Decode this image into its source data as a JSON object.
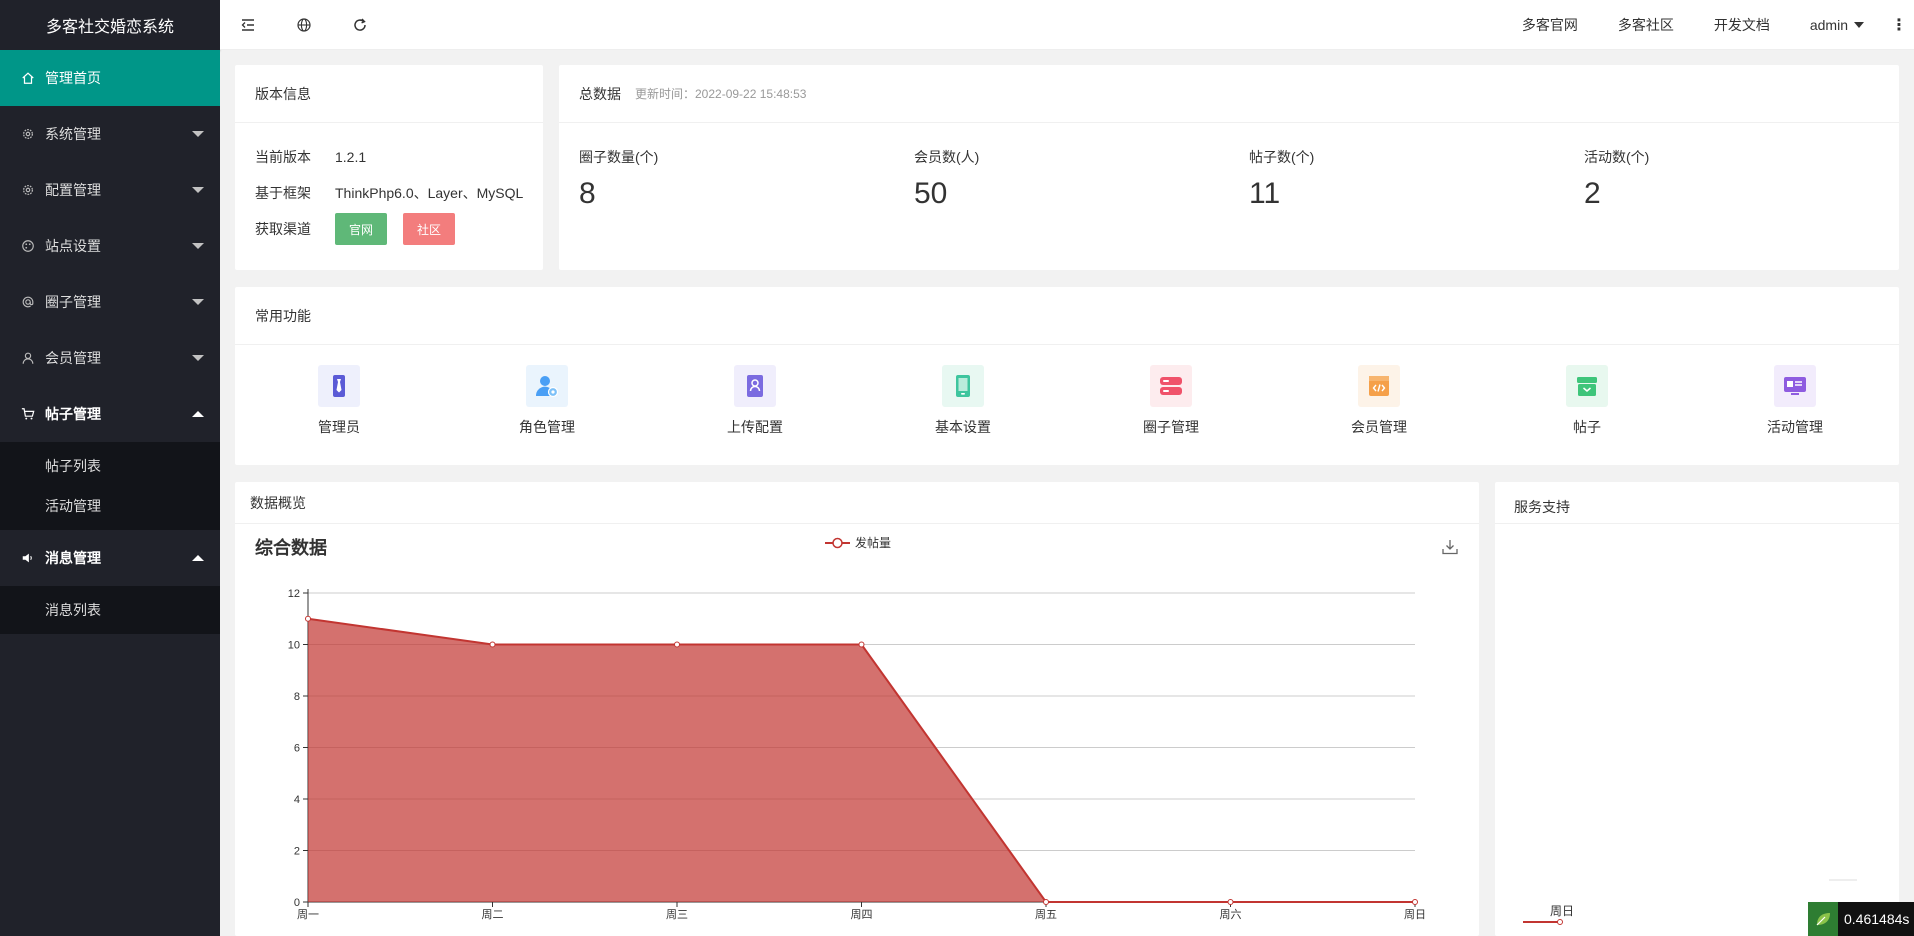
{
  "app": {
    "title": "多客社交婚恋系统"
  },
  "sidebar": {
    "items": [
      {
        "label": "管理首页",
        "icon": "home-icon",
        "state": "active"
      },
      {
        "label": "系统管理",
        "icon": "gear-icon",
        "state": "collapsed"
      },
      {
        "label": "配置管理",
        "icon": "gear-icon",
        "state": "collapsed"
      },
      {
        "label": "站点设置",
        "icon": "palette-icon",
        "state": "collapsed"
      },
      {
        "label": "圈子管理",
        "icon": "at-icon",
        "state": "collapsed"
      },
      {
        "label": "会员管理",
        "icon": "user-icon",
        "state": "collapsed"
      },
      {
        "label": "帖子管理",
        "icon": "cart-icon",
        "state": "expanded",
        "children": [
          "帖子列表",
          "活动管理"
        ]
      },
      {
        "label": "消息管理",
        "icon": "speaker-icon",
        "state": "expanded",
        "children": [
          "消息列表"
        ]
      }
    ]
  },
  "header": {
    "links": [
      "多客官网",
      "多客社区",
      "开发文档"
    ],
    "user": "admin"
  },
  "version_card": {
    "title": "版本信息",
    "rows": [
      {
        "key": "当前版本",
        "value": "1.2.1"
      },
      {
        "key": "基于框架",
        "value": "ThinkPhp6.0、Layer、MySQL"
      },
      {
        "key": "获取渠道"
      }
    ],
    "btn_official": "官网",
    "btn_community": "社区"
  },
  "totals": {
    "title": "总数据",
    "updated": "更新时间：2022-09-22 15:48:53",
    "items": [
      {
        "label": "圈子数量(个)",
        "value": "8"
      },
      {
        "label": "会员数(人)",
        "value": "50"
      },
      {
        "label": "帖子数(个)",
        "value": "11"
      },
      {
        "label": "活动数(个)",
        "value": "2"
      }
    ]
  },
  "functions": {
    "title": "常用功能",
    "items": [
      {
        "label": "管理员",
        "icon": "tie-icon",
        "color": "#5b5bd6",
        "bg": "#eef0fc"
      },
      {
        "label": "角色管理",
        "icon": "user-settings-icon",
        "color": "#4a9ff5",
        "bg": "#eaf4fd"
      },
      {
        "label": "上传配置",
        "icon": "contact-book-icon",
        "color": "#7b6be0",
        "bg": "#f0eefc"
      },
      {
        "label": "基本设置",
        "icon": "phone-icon",
        "color": "#3ec59e",
        "bg": "#e8f8f2"
      },
      {
        "label": "圈子管理",
        "icon": "server-icon",
        "color": "#f0526a",
        "bg": "#fdecee"
      },
      {
        "label": "会员管理",
        "icon": "code-window-icon",
        "color": "#f5a04a",
        "bg": "#fdf3e8"
      },
      {
        "label": "帖子",
        "icon": "archive-icon",
        "color": "#3ec57a",
        "bg": "#e8f8ef"
      },
      {
        "label": "活动管理",
        "icon": "monitor-card-icon",
        "color": "#8e5ce0",
        "bg": "#f2ecfc"
      }
    ]
  },
  "overview": {
    "title": "数据概览"
  },
  "service": {
    "title": "服务支持",
    "chart_tick": "周日"
  },
  "timer": {
    "value": "0.461484s"
  },
  "chart_data": {
    "type": "area",
    "title": "综合数据",
    "categories": [
      "周一",
      "周二",
      "周三",
      "周四",
      "周五",
      "周六",
      "周日"
    ],
    "series": [
      {
        "name": "发帖量",
        "values": [
          11,
          10,
          10,
          10,
          0,
          0,
          0
        ],
        "color": "#c23531"
      }
    ],
    "ylim": [
      0,
      12
    ],
    "yticks": [
      0,
      2,
      4,
      6,
      8,
      10,
      12
    ],
    "grid": true,
    "legend": "top-center"
  }
}
